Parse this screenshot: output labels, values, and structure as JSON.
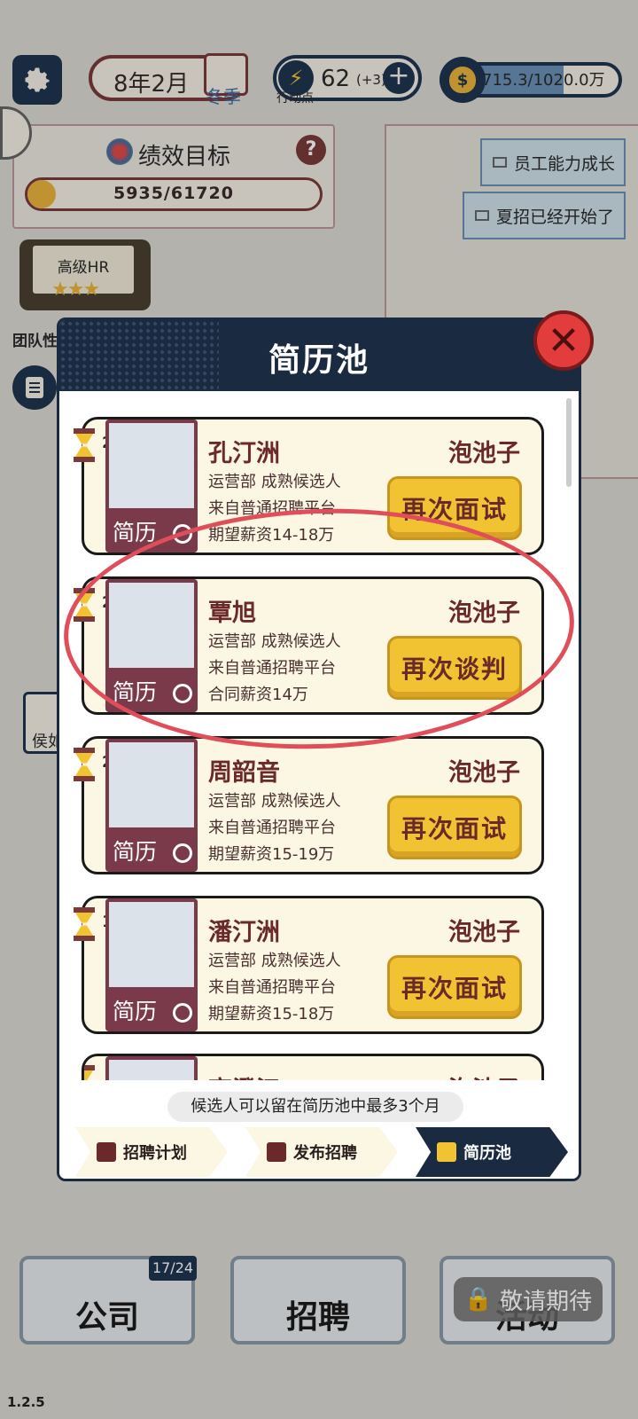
{
  "topbar": {
    "date": "8年2月",
    "season": "冬季",
    "energy_value": "62",
    "energy_bonus": "(+3)",
    "energy_label": "行动点",
    "money": "715.3/1020.0万"
  },
  "performance": {
    "title": "绩效目标",
    "help": "?",
    "value": "5935/61720",
    "progress": 0.096
  },
  "mail": [
    {
      "label": "员工能力成长"
    },
    {
      "label": "夏招已经开始了"
    }
  ],
  "hr_level": {
    "label": "高级HR",
    "stars": "★★★"
  },
  "team_label": "团队性",
  "hou_label": "侯如",
  "dialog": {
    "title": "简历池",
    "close": "✕",
    "tip": "候选人可以留在简历池中最多3个月",
    "candidates": [
      {
        "name": "孔汀洲",
        "status": "泡池子",
        "line1": "运营部 成熟候选人",
        "line2": "来自普通招聘平台",
        "line3": "期望薪资14-18万",
        "button": "再次面试",
        "resume": "简历",
        "months": "2"
      },
      {
        "name": "覃旭",
        "status": "泡池子",
        "line1": "运营部 成熟候选人",
        "line2": "来自普通招聘平台",
        "line3": "合同薪资14万",
        "button": "再次谈判",
        "resume": "简历",
        "months": "2"
      },
      {
        "name": "周韶音",
        "status": "泡池子",
        "line1": "运营部 成熟候选人",
        "line2": "来自普通招聘平台",
        "line3": "期望薪资15-19万",
        "button": "再次面试",
        "resume": "简历",
        "months": "2"
      },
      {
        "name": "潘汀洲",
        "status": "泡池子",
        "line1": "运营部 成熟候选人",
        "line2": "来自普通招聘平台",
        "line3": "期望薪资15-18万",
        "button": "再次面试",
        "resume": "简历",
        "months": "1"
      },
      {
        "name": "高澄江",
        "status": "泡池子",
        "line1": "",
        "line2": "",
        "line3": "",
        "button": "",
        "resume": "",
        "months": ""
      }
    ],
    "tabs": [
      {
        "label": "招聘计划"
      },
      {
        "label": "发布招聘"
      },
      {
        "label": "简历池"
      }
    ]
  },
  "bottom_nav": {
    "company": "公司",
    "company_badge": "17/24",
    "recruit": "招聘",
    "activity": "活动",
    "locked": "敬请期待"
  },
  "version": "1.2.5"
}
